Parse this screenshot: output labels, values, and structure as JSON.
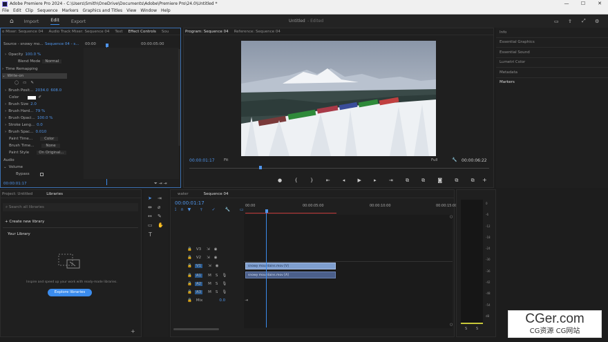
{
  "window": {
    "title": "Adobe Premiere Pro 2024 - C:\\Users\\Smith\\OneDrive\\Documents\\Adobe\\Premiere Pro\\24.0\\Untitled *",
    "min": "—",
    "max": "☐",
    "close": "✕"
  },
  "menu": [
    "File",
    "Edit",
    "Clip",
    "Sequence",
    "Markers",
    "Graphics and Titles",
    "View",
    "Window",
    "Help"
  ],
  "appbar": {
    "workspaces": [
      "Import",
      "Edit",
      "Export"
    ],
    "project_title": "Untitled",
    "project_state": "- Edited"
  },
  "effect_controls": {
    "tabs": [
      "o Mixer: Sequence 04",
      "Audio Track Mixer: Sequence 04",
      "Text",
      "Effect Controls",
      "Sou"
    ],
    "source": "Source - snowy mo...",
    "sequence": "Sequence 04 - s...",
    "time_start": "00:00",
    "time_mid": "00:00:05:00",
    "rows": [
      {
        "label": "Opacity",
        "value": "100.0 %"
      },
      {
        "label": "Blend Mode",
        "value": "Normal"
      },
      {
        "label": "Time Remapping",
        "value": ""
      },
      {
        "label": "Write-on",
        "value": ""
      },
      {
        "label": "Brush Posit...",
        "value": "2034.0"
      },
      {
        "label": "Color",
        "value": ""
      },
      {
        "label": "Brush Size",
        "value": "2.0"
      },
      {
        "label": "Brush Hard...",
        "value": "79 %"
      },
      {
        "label": "Brush Opaci...",
        "value": "100.0 %"
      },
      {
        "label": "Stroke Leng...",
        "value": "0.0"
      },
      {
        "label": "Brush Spac...",
        "value": "0.010"
      },
      {
        "label": "Paint Time...",
        "value": "Color"
      },
      {
        "label": "Brush Time...",
        "value": "None"
      },
      {
        "label": "Paint Style",
        "value": "On Original..."
      },
      {
        "label": "Audio",
        "value": ""
      },
      {
        "label": "Volume",
        "value": ""
      },
      {
        "label": "Bypass",
        "value": ""
      }
    ],
    "brush_pos_y": "608.0",
    "timecode": "00:00:01:17"
  },
  "program": {
    "tabs": [
      "Program: Sequence 04",
      "Reference: Sequence 04"
    ],
    "timecode": "00:00:01:17",
    "fit": "Fit",
    "quality": "Full",
    "duration": "00:00:06:22"
  },
  "right_panels": [
    "Info",
    "Essential Graphics",
    "Essential Sound",
    "Lumetri Color",
    "Metadata",
    "Markers"
  ],
  "project": {
    "tabs": [
      "Project: Untitled",
      "Libraries"
    ],
    "search_placeholder": "Search all libraries",
    "create_label": "Create new library",
    "your_library": "Your Library",
    "empty_text": "Inspire and speed up your work with ready-made libraries.",
    "explore_button": "Explore libraries"
  },
  "timeline": {
    "tabs": [
      "water",
      "Sequence 04"
    ],
    "timecode": "00:00:01:17",
    "ruler": [
      "00:00",
      "00:00:05:00",
      "00:00:10:00",
      "00:00:15:00"
    ],
    "tracks": [
      {
        "name": "V3",
        "kind": "video"
      },
      {
        "name": "V2",
        "kind": "video"
      },
      {
        "name": "V1",
        "kind": "video"
      },
      {
        "name": "A1",
        "kind": "audio"
      },
      {
        "name": "A2",
        "kind": "audio"
      },
      {
        "name": "A3",
        "kind": "audio"
      }
    ],
    "mix_label": "Mix",
    "mix_value": "0.0",
    "video_clip": "snowy mountains.mov [V]",
    "audio_clip": "snowy mountains.mov [A]"
  },
  "audio_meter": {
    "scale": [
      "0",
      "-6",
      "-12",
      "-18",
      "-24",
      "-30",
      "-36",
      "-42",
      "-48",
      "-54",
      "dB"
    ],
    "solo_labels": [
      "S",
      "S"
    ]
  },
  "watermark": {
    "brand": "CGer.com",
    "subtitle": "CG资源 CG网站"
  }
}
